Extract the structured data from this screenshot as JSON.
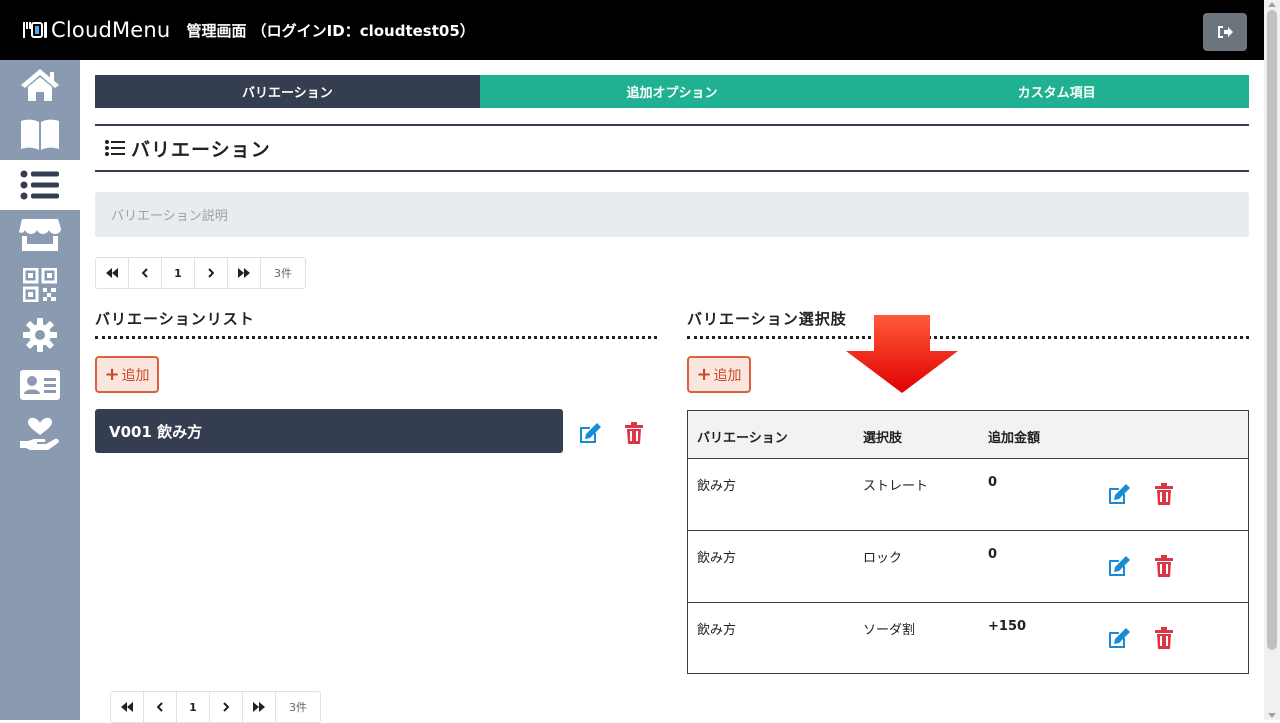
{
  "header": {
    "brand": "CloudMenu",
    "admin_title": "管理画面 （ログインID：cloudtest05）"
  },
  "sidebar": {
    "items": [
      {
        "icon": "home-icon"
      },
      {
        "icon": "book-icon"
      },
      {
        "icon": "list-icon",
        "active": true
      },
      {
        "icon": "store-icon"
      },
      {
        "icon": "qr-code-icon"
      },
      {
        "icon": "gear-icon"
      },
      {
        "icon": "id-card-icon"
      },
      {
        "icon": "heart-hand-icon"
      }
    ]
  },
  "tabs": [
    "バリエーション",
    "追加オプション",
    "カスタム項目"
  ],
  "section": {
    "title": "バリエーション",
    "description": "バリエーション説明"
  },
  "pager_top": {
    "first": "⯬",
    "prev": "‹",
    "page": "1",
    "next": "›",
    "last": "⯮",
    "count": "3件"
  },
  "pager_bottom": {
    "first": "⯬",
    "prev": "‹",
    "page": "1",
    "next": "›",
    "last": "⯮",
    "count": "3件"
  },
  "variation_list": {
    "title": "バリエーションリスト",
    "add_label": "追加",
    "items": [
      {
        "label": "V001 飲み方"
      }
    ]
  },
  "options": {
    "title": "バリエーション選択肢",
    "add_label": "追加",
    "columns": [
      "バリエーション",
      "選択肢",
      "追加金額"
    ],
    "rows": [
      {
        "variation": "飲み方",
        "choice": "ストレート",
        "price": "0"
      },
      {
        "variation": "飲み方",
        "choice": "ロック",
        "price": "0"
      },
      {
        "variation": "飲み方",
        "choice": "ソーダ割",
        "price": "+150"
      }
    ]
  },
  "colors": {
    "sidebar": "#8a9bb1",
    "active_tab": "#343e50",
    "tab": "#20b192",
    "edit": "#1a8bd6",
    "delete": "#dc3545",
    "add_border": "#d9603b"
  }
}
